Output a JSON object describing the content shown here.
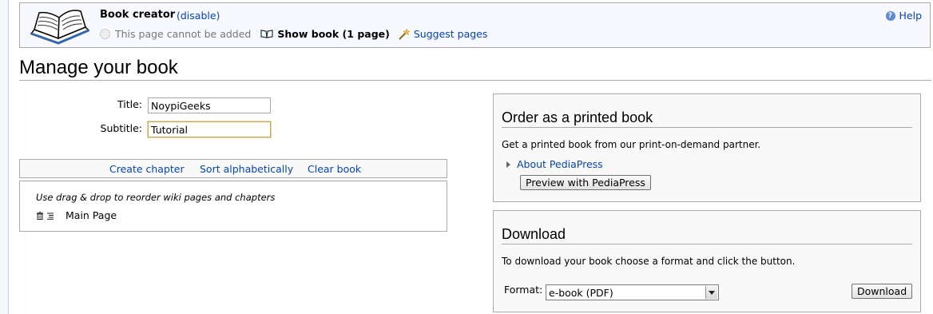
{
  "book_creator": {
    "title": "Book creator",
    "disable_label": "(disable)",
    "cannot_add": "This page cannot be added",
    "show_book": "Show book (1 page)",
    "suggest_pages": "Suggest pages",
    "help": "Help"
  },
  "page_title": "Manage your book",
  "form": {
    "title_label": "Title:",
    "title_value": "NoypiGeeks",
    "subtitle_label": "Subtitle:",
    "subtitle_value": "Tutorial"
  },
  "toolbar": {
    "create_chapter": "Create chapter",
    "sort_alphabetically": "Sort alphabetically",
    "clear_book": "Clear book"
  },
  "book_list": {
    "hint": "Use drag & drop to reorder wiki pages and chapters",
    "items": [
      {
        "title": "Main Page"
      }
    ]
  },
  "order_panel": {
    "heading": "Order as a printed book",
    "description": "Get a printed book from our print-on-demand partner.",
    "about_link": "About PediaPress",
    "preview_button": "Preview with PediaPress"
  },
  "download_panel": {
    "heading": "Download",
    "description": "To download your book choose a format and click the button.",
    "format_label": "Format:",
    "format_selected": "e-book (PDF)",
    "download_button": "Download"
  }
}
